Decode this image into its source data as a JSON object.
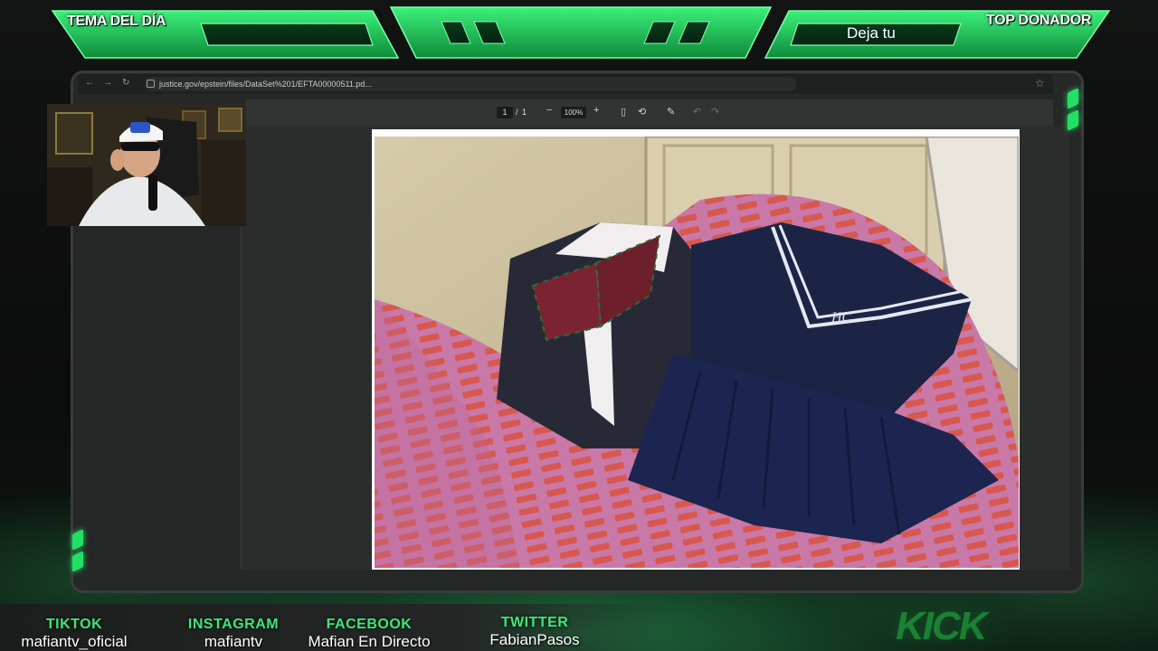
{
  "overlay": {
    "left_panel_label": "TEMA DEL DÍA",
    "right_panel_label": "TOP DONADOR",
    "right_panel_value": "Deja tu",
    "accent_color": "#22e065",
    "dark_green": "#0f7a32"
  },
  "browser": {
    "url": "justice.gov/epstein/files/DataSet%201/EFTA00000511.pd...",
    "back_icon": "arrow-left-icon",
    "forward_icon": "arrow-right-icon",
    "reload_icon": "reload-icon",
    "bookmark_icon": "star-icon"
  },
  "pdf_toolbar": {
    "current_page": "1",
    "page_separator": "/",
    "total_pages": "1",
    "zoom_out": "−",
    "zoom_level": "100%",
    "zoom_in": "+"
  },
  "socials": [
    {
      "label": "TIKTOK",
      "handle": "mafiantv_oficial"
    },
    {
      "label": "INSTAGRAM",
      "handle": "mafiantv"
    },
    {
      "label": "FACEBOOK",
      "handle": "Mafian En Directo"
    },
    {
      "label": "TWITTER",
      "handle": "FabianPasos"
    }
  ],
  "kick_logo": "KICK"
}
